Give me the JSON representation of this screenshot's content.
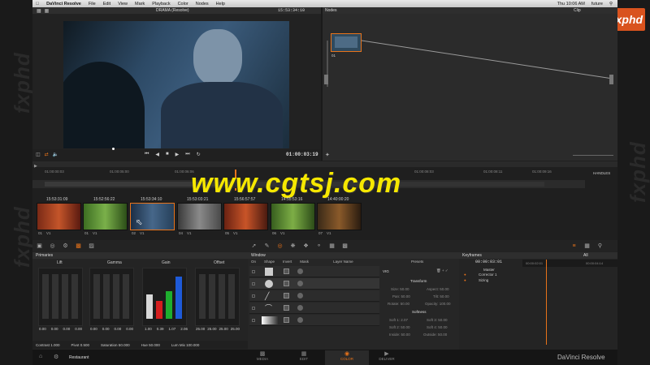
{
  "watermark": {
    "side_text": "fxphd",
    "center_text": "www.cgtsj.com",
    "logo": "fxphd"
  },
  "menubar": {
    "app": "DaVinci Resolve",
    "items": [
      "File",
      "Edit",
      "View",
      "Mark",
      "Playback",
      "Color",
      "Nodes",
      "Help"
    ],
    "clock": "Thu 10:06 AM",
    "user": "future"
  },
  "viewer": {
    "title": "DRAMA (Resolve)",
    "timecode_top": "15:53:34:10",
    "timecode": "01:00:03:19"
  },
  "nodes": {
    "title": "Nodes",
    "clip_label": "Clip",
    "node_label": "01"
  },
  "timeline": {
    "ruler": [
      "01:00:00:03",
      "01:00:05:00",
      "01:00:06:06",
      "01:00:08:03",
      "01:00:08:11",
      "01:00:09:16"
    ],
    "handles": "HANDLES",
    "clips": [
      {
        "tc": "15:53:31:09",
        "lbl": "01",
        "track": "V1"
      },
      {
        "tc": "15:52:56:22",
        "lbl": "01",
        "track": "V1"
      },
      {
        "tc": "15:53:34:10",
        "lbl": "02",
        "track": "V1"
      },
      {
        "tc": "15:53:03:21",
        "lbl": "04",
        "track": "V1"
      },
      {
        "tc": "15:56:57:57",
        "lbl": "05",
        "track": "V1"
      },
      {
        "tc": "14:55:53:16",
        "lbl": "06",
        "track": "V1"
      },
      {
        "tc": "14:40:00:20",
        "lbl": "07",
        "track": "V1"
      }
    ]
  },
  "primaries": {
    "title": "Primaries",
    "wheels": [
      "Lift",
      "Gamma",
      "Gain",
      "Offset"
    ],
    "lift_vals": [
      "0.00",
      "0.00",
      "0.00",
      "0.00"
    ],
    "gamma_vals": [
      "0.00",
      "0.00",
      "0.00",
      "0.00"
    ],
    "gain_vals": [
      "1.00",
      "0.39",
      "1.07",
      "2.06"
    ],
    "offset_vals": [
      "25.00",
      "25.00",
      "25.00",
      "25.00"
    ],
    "contrast": "Contrast 1.000",
    "pivot": "Pivot 0.500",
    "saturation": "Saturation 50.000",
    "hue": "Hue 50.000",
    "lummix": "Lum Mix 100.000"
  },
  "window": {
    "title": "Window",
    "cols": [
      "On",
      "Shape",
      "Invert",
      "Mask",
      "Layer Name"
    ],
    "presets": "Presets",
    "vig": "VIG",
    "transform": "Transform",
    "size": "Size: 50.00",
    "aspect": "Aspect: 50.00",
    "pan": "Pan: 50.00",
    "tilt": "Tilt: 50.00",
    "rotate": "Rotate: 50.00",
    "opacity": "Opacity: 100.00",
    "softness": "Softness",
    "soft1": "Soft 1: 2.07",
    "soft3": "Soft 3: 50.00",
    "soft2": "Soft 2: 50.00",
    "soft4": "Soft 4: 50.00",
    "inside": "Inside: 50.00",
    "outside": "Outside: 50.00"
  },
  "keyframes": {
    "title": "Keyframes",
    "filter": "All",
    "timecode": "00:00:03:01",
    "tc_a": "00:00:02:01",
    "tc_b": "00:00:04:14",
    "tracks": [
      "Master",
      "Corrector 1",
      "Sizing"
    ]
  },
  "bottombar": {
    "project": "Restaurant",
    "tabs": [
      "MEDIA",
      "EDIT",
      "COLOR",
      "DELIVER"
    ],
    "brand": "DaVinci Resolve"
  }
}
